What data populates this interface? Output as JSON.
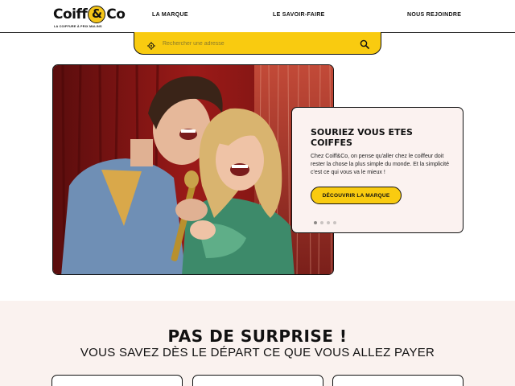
{
  "brand": {
    "logo_left": "Coiff",
    "logo_amp": "&",
    "logo_right": "Co",
    "tagline": "LA COIFFURE À PRIX MALINS",
    "accent_color": "#f9cb10"
  },
  "nav": {
    "items": [
      {
        "label": "LA MARQUE"
      },
      {
        "label": "LE SAVOIR-FAIRE"
      },
      {
        "label": "NOUS REJOINDRE"
      }
    ]
  },
  "search": {
    "placeholder": "Rechercher une adresse",
    "value": "",
    "location_icon": "crosshair-icon",
    "submit_icon": "search-icon"
  },
  "hero": {
    "image_icon": "hero-photo",
    "title": "SOURIEZ VOUS ETES COIFFES",
    "text": "Chez Coiff&Co, on pense qu'aller chez le coiffeur doit rester la chose la plus simple du monde. Et la simplicité c'est ce qui vous va le mieux !",
    "cta_label": "DÉCOUVRIR LA MARQUE",
    "carousel": {
      "count": 4,
      "active_index": 0
    }
  },
  "pricing": {
    "title": "PAS DE SURPRISE !",
    "subtitle": "VOUS SAVEZ DÈS LE DÉPART CE QUE VOUS ALLEZ PAYER",
    "background_color": "#faf2ef"
  }
}
